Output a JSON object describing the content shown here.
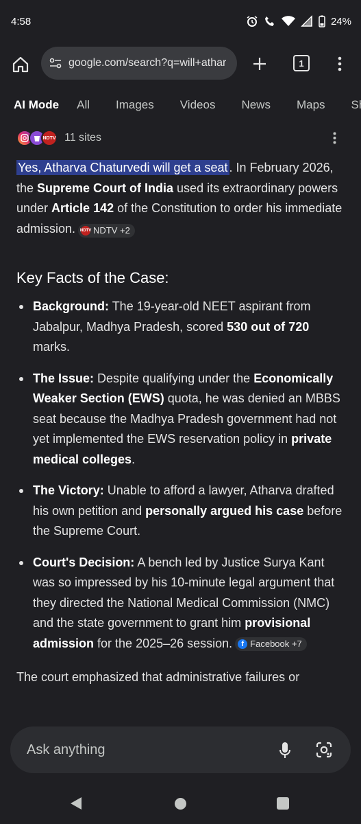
{
  "status_bar": {
    "time": "4:58",
    "battery": "24%"
  },
  "browser": {
    "url": "google.com/search?q=will+athar",
    "tab_count": "1"
  },
  "search_tabs": [
    "AI Mode",
    "All",
    "Images",
    "Videos",
    "News",
    "Maps",
    "Shoppin"
  ],
  "sources": {
    "count_label": "11 sites",
    "ndtv_logo": "NDTV"
  },
  "answer": {
    "highlight": "Yes, Atharva Chaturvedi will get a seat",
    "p1_a": ". In February 2026, the ",
    "p1_b": "Supreme Court of India",
    "p1_c": " used its extraordinary powers under ",
    "p1_d": "Article 142",
    "p1_e": " of the Constitution to order his immediate admission.",
    "chip1": "NDTV +2"
  },
  "key_facts": {
    "heading": "Key Facts of the Case:",
    "items": [
      {
        "label": "Background:",
        "t1": " The 19-year-old NEET aspirant from Jabalpur, Madhya Pradesh, scored ",
        "b1": "530 out of 720",
        "t2": " marks."
      },
      {
        "label": "The Issue:",
        "t1": " Despite qualifying under the ",
        "b1": "Economically Weaker Section (EWS)",
        "t2": " quota, he was denied an MBBS seat because the Madhya Pradesh government had not yet implemented the EWS reservation policy in ",
        "b2": "private medical colleges",
        "t3": "."
      },
      {
        "label": "The Victory:",
        "t1": " Unable to afford a lawyer, Atharva drafted his own petition and ",
        "b1": "personally argued his case",
        "t2": " before the Supreme Court."
      },
      {
        "label": "Court's Decision:",
        "t1": " A bench led by Justice Surya Kant was so impressed by his 10-minute legal argument that they directed the National Medical Commission (NMC) and the state government to grant him ",
        "b1": "provisional admission",
        "t2": " for the 2025–26 session.",
        "chip": "Facebook +7"
      }
    ]
  },
  "trailing_text": "The court emphasized that administrative failures or",
  "ask": {
    "placeholder": "Ask anything"
  }
}
